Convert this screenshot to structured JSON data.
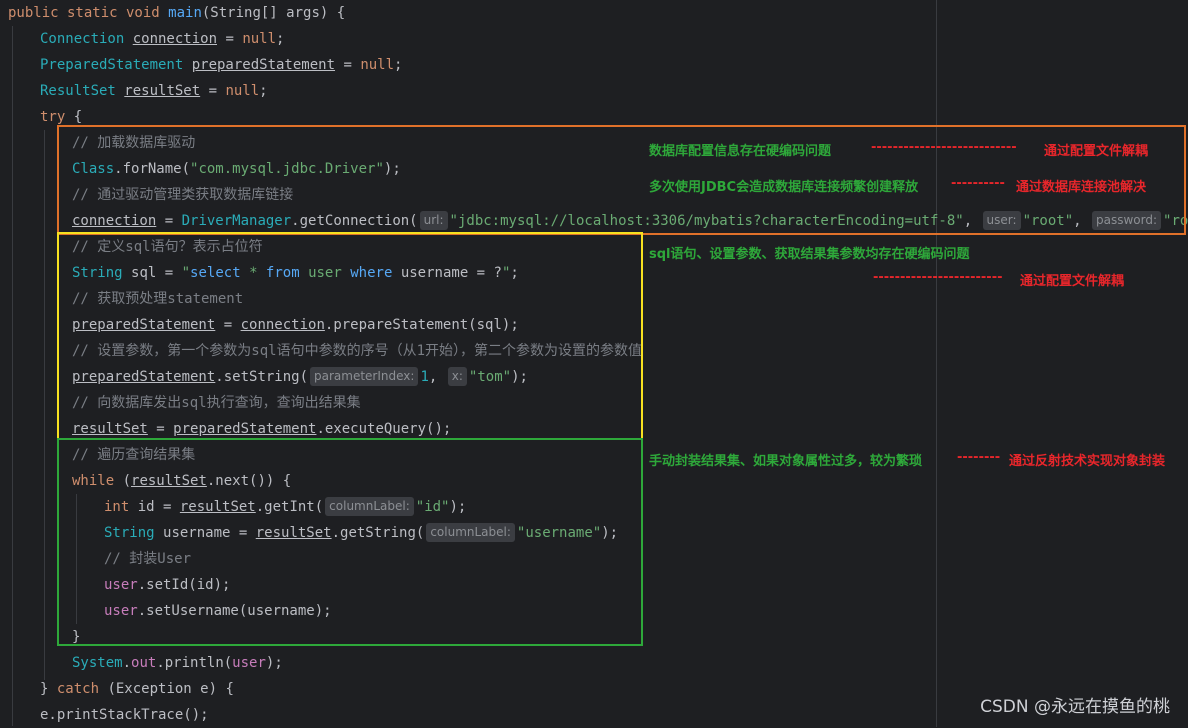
{
  "code_lines": [
    {
      "segments": [
        {
          "t": "public static void ",
          "c": "kw"
        },
        {
          "t": "main",
          "c": "fn"
        },
        {
          "t": "(String[] args) {",
          "c": "type"
        }
      ]
    },
    {
      "segments": [
        {
          "t": "Connection ",
          "c": "cls"
        },
        {
          "t": "connection",
          "c": "type",
          "u": true
        },
        {
          "t": " = ",
          "c": "type"
        },
        {
          "t": "null",
          "c": "kw"
        },
        {
          "t": ";",
          "c": "type"
        }
      ]
    },
    {
      "segments": [
        {
          "t": "PreparedStatement ",
          "c": "cls"
        },
        {
          "t": "preparedStatement",
          "c": "type",
          "u": true
        },
        {
          "t": " = ",
          "c": "type"
        },
        {
          "t": "null",
          "c": "kw"
        },
        {
          "t": ";",
          "c": "type"
        }
      ]
    },
    {
      "segments": [
        {
          "t": "ResultSet ",
          "c": "cls"
        },
        {
          "t": "resultSet",
          "c": "type",
          "u": true
        },
        {
          "t": " = ",
          "c": "type"
        },
        {
          "t": "null",
          "c": "kw"
        },
        {
          "t": ";",
          "c": "type"
        }
      ]
    },
    {
      "segments": [
        {
          "t": "try",
          "c": "kw"
        },
        {
          "t": " {",
          "c": "type"
        }
      ]
    },
    {
      "segments": [
        {
          "t": "// 加载数据库驱动",
          "c": "cmt"
        }
      ]
    },
    {
      "segments": [
        {
          "t": "Class",
          "c": "cls"
        },
        {
          "t": ".forName(",
          "c": "type"
        },
        {
          "t": "\"com.mysql.jdbc.Driver\"",
          "c": "str"
        },
        {
          "t": ");",
          "c": "type"
        }
      ]
    },
    {
      "segments": [
        {
          "t": "// 通过驱动管理类获取数据库链接",
          "c": "cmt"
        }
      ]
    },
    {
      "segments": [
        {
          "t": "connection",
          "c": "type",
          "u": true
        },
        {
          "t": " = ",
          "c": "type"
        },
        {
          "t": "DriverManager",
          "c": "cls"
        },
        {
          "t": ".getConnection(",
          "c": "type"
        },
        {
          "h": "url:"
        },
        {
          "t": "\"jdbc:mysql://localhost:3306/mybatis?characterEncoding=utf-8\"",
          "c": "str"
        },
        {
          "t": ", ",
          "c": "type"
        },
        {
          "h": "user:"
        },
        {
          "t": "\"root\"",
          "c": "str"
        },
        {
          "t": ", ",
          "c": "type"
        },
        {
          "h": "password:"
        },
        {
          "t": "\"root\"",
          "c": "str"
        },
        {
          "t": ");",
          "c": "type"
        }
      ]
    },
    {
      "segments": [
        {
          "t": "// 定义sql语句？表示占位符",
          "c": "cmt"
        }
      ]
    },
    {
      "segments": [
        {
          "t": "String ",
          "c": "cls"
        },
        {
          "t": "sql",
          "c": "type"
        },
        {
          "t": " = ",
          "c": "type"
        },
        {
          "t": "\"",
          "c": "str"
        },
        {
          "t": "select ",
          "c": "fn"
        },
        {
          "t": "* ",
          "c": "str"
        },
        {
          "t": "from ",
          "c": "fn"
        },
        {
          "t": "user ",
          "c": "str"
        },
        {
          "t": "where ",
          "c": "fn"
        },
        {
          "t": "username = ?",
          "c": "type"
        },
        {
          "t": "\"",
          "c": "str"
        },
        {
          "t": ";",
          "c": "type"
        }
      ]
    },
    {
      "segments": [
        {
          "t": "// 获取预处理statement",
          "c": "cmt"
        }
      ]
    },
    {
      "segments": [
        {
          "t": "preparedStatement",
          "c": "type",
          "u": true
        },
        {
          "t": " = ",
          "c": "type"
        },
        {
          "t": "connection",
          "c": "type",
          "u": true
        },
        {
          "t": ".prepareStatement(sql);",
          "c": "type"
        }
      ]
    },
    {
      "segments": [
        {
          "t": "// 设置参数，第一个参数为sql语句中参数的序号（从1开始），第二个参数为设置的参数值",
          "c": "cmt"
        }
      ]
    },
    {
      "segments": [
        {
          "t": "preparedStatement",
          "c": "type",
          "u": true
        },
        {
          "t": ".setString(",
          "c": "type"
        },
        {
          "h": "parameterIndex:"
        },
        {
          "t": "1",
          "c": "num"
        },
        {
          "t": ", ",
          "c": "type"
        },
        {
          "h": "x:"
        },
        {
          "t": "\"tom\"",
          "c": "str"
        },
        {
          "t": ");",
          "c": "type"
        }
      ]
    },
    {
      "segments": [
        {
          "t": "// 向数据库发出sql执行查询，查询出结果集",
          "c": "cmt"
        }
      ]
    },
    {
      "segments": [
        {
          "t": "resultSet",
          "c": "type",
          "u": true
        },
        {
          "t": " = ",
          "c": "type"
        },
        {
          "t": "preparedStatement",
          "c": "type",
          "u": true
        },
        {
          "t": ".executeQuery();",
          "c": "type"
        }
      ]
    },
    {
      "segments": [
        {
          "t": "// 遍历查询结果集",
          "c": "cmt"
        }
      ]
    },
    {
      "segments": [
        {
          "t": "while",
          "c": "kw"
        },
        {
          "t": " (",
          "c": "type"
        },
        {
          "t": "resultSet",
          "c": "type",
          "u": true
        },
        {
          "t": ".next()) {",
          "c": "type"
        }
      ]
    },
    {
      "segments": [
        {
          "t": "int ",
          "c": "kw"
        },
        {
          "t": "id = ",
          "c": "type"
        },
        {
          "t": "resultSet",
          "c": "type",
          "u": true
        },
        {
          "t": ".getInt(",
          "c": "type"
        },
        {
          "h": "columnLabel:"
        },
        {
          "t": "\"id\"",
          "c": "str"
        },
        {
          "t": ");",
          "c": "type"
        }
      ]
    },
    {
      "segments": [
        {
          "t": "String ",
          "c": "cls"
        },
        {
          "t": "username = ",
          "c": "type"
        },
        {
          "t": "resultSet",
          "c": "type",
          "u": true
        },
        {
          "t": ".getString(",
          "c": "type"
        },
        {
          "h": "columnLabel:"
        },
        {
          "t": "\"username\"",
          "c": "str"
        },
        {
          "t": ");",
          "c": "type"
        }
      ]
    },
    {
      "segments": [
        {
          "t": "// 封装User",
          "c": "cmt"
        }
      ]
    },
    {
      "segments": [
        {
          "t": "user",
          "c": "field"
        },
        {
          "t": ".setId(id);",
          "c": "type"
        }
      ]
    },
    {
      "segments": [
        {
          "t": "user",
          "c": "field"
        },
        {
          "t": ".setUsername(username);",
          "c": "type"
        }
      ]
    },
    {
      "segments": [
        {
          "t": "}",
          "c": "type"
        }
      ]
    },
    {
      "segments": [
        {
          "t": "System",
          "c": "cls"
        },
        {
          "t": ".",
          "c": "type"
        },
        {
          "t": "out",
          "c": "field"
        },
        {
          "t": ".println(",
          "c": "type"
        },
        {
          "t": "user",
          "c": "field"
        },
        {
          "t": ");",
          "c": "type"
        }
      ]
    },
    {
      "segments": [
        {
          "t": "} ",
          "c": "type"
        },
        {
          "t": "catch",
          "c": "kw"
        },
        {
          "t": " (Exception e) {",
          "c": "type"
        }
      ]
    },
    {
      "segments": [
        {
          "t": "e.printStackTrace();",
          "c": "type"
        }
      ]
    }
  ],
  "annotations": {
    "a1_problem": "数据库配置信息存在硬编码问题",
    "a1_dash": "---------------------------",
    "a1_fix": "通过配置文件解耦",
    "a2_problem": "多次使用JDBC会造成数据库连接频繁创建释放",
    "a2_dash": "----------",
    "a2_fix": "通过数据库连接池解决",
    "a3_problem": "sql语句、设置参数、获取结果集参数均存在硬编码问题",
    "a3_dash": "------------------------",
    "a3_fix": "通过配置文件解耦",
    "a4_problem": "手动封装结果集、如果对象属性过多，较为繁琐",
    "a4_dash": "--------",
    "a4_fix": "通过反射技术实现对象封装"
  },
  "watermark": "CSDN @永远在摸鱼的桃",
  "colors": {
    "orange_box": "#e0712a",
    "yellow_box": "#f7e120",
    "green_box": "#2ea83a",
    "green_text": "#2ea83a",
    "red_text": "#e8262b"
  }
}
